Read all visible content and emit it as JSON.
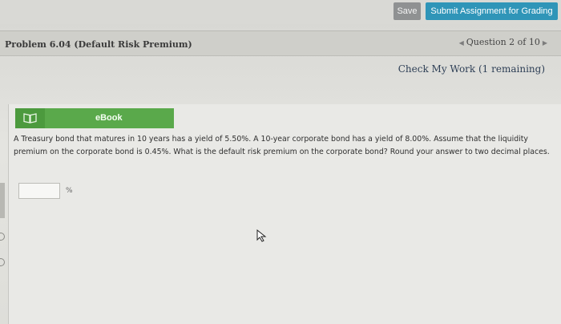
{
  "toolbar": {
    "save_label": "Save",
    "submit_label": "Submit Assignment for Grading"
  },
  "header": {
    "problem_title": "Problem 6.04 (Default Risk Premium)",
    "question_nav": "Question 2 of 10"
  },
  "check_work": "Check My Work (1 remaining)",
  "ebook": {
    "label": "eBook"
  },
  "question": {
    "text": "A Treasury bond that matures in 10 years has a yield of 5.50%. A 10-year corporate bond has a yield of 8.00%. Assume that the liquidity premium on the corporate bond is 0.45%. What is the default risk premium on the corporate bond? Round your answer to two decimal places.",
    "answer_value": "",
    "unit": "%"
  },
  "colors": {
    "submit_button": "#2f95b8",
    "save_button": "#8f9192",
    "ebook_bar": "#5aa94b"
  },
  "icons": [
    "book-icon",
    "prev-arrow-icon",
    "next-arrow-icon",
    "mouse-cursor-icon"
  ]
}
